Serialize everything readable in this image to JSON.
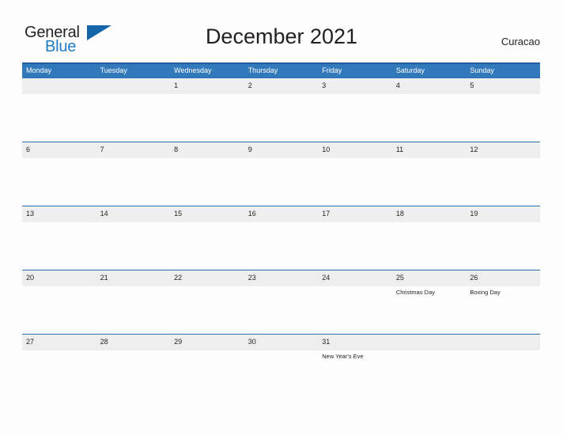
{
  "brand": {
    "name_part1": "General",
    "name_part2": "Blue",
    "flag_icon": "blue-triangle-flag"
  },
  "header": {
    "title": "December 2021",
    "region": "Curacao"
  },
  "colors": {
    "header_blue": "#3279bc",
    "divider_blue": "#2a6fb0",
    "band_gray": "#eeeeee",
    "brand_blue": "#1f7ac4",
    "text": "#231f20",
    "page_background": "#fdfdfd"
  },
  "calendar": {
    "weekday_headers": [
      "Monday",
      "Tuesday",
      "Wednesday",
      "Thursday",
      "Friday",
      "Saturday",
      "Sunday"
    ],
    "weeks": [
      [
        {
          "num": "",
          "event": ""
        },
        {
          "num": "",
          "event": ""
        },
        {
          "num": "1",
          "event": ""
        },
        {
          "num": "2",
          "event": ""
        },
        {
          "num": "3",
          "event": ""
        },
        {
          "num": "4",
          "event": ""
        },
        {
          "num": "5",
          "event": ""
        }
      ],
      [
        {
          "num": "6",
          "event": ""
        },
        {
          "num": "7",
          "event": ""
        },
        {
          "num": "8",
          "event": ""
        },
        {
          "num": "9",
          "event": ""
        },
        {
          "num": "10",
          "event": ""
        },
        {
          "num": "11",
          "event": ""
        },
        {
          "num": "12",
          "event": ""
        }
      ],
      [
        {
          "num": "13",
          "event": ""
        },
        {
          "num": "14",
          "event": ""
        },
        {
          "num": "15",
          "event": ""
        },
        {
          "num": "16",
          "event": ""
        },
        {
          "num": "17",
          "event": ""
        },
        {
          "num": "18",
          "event": ""
        },
        {
          "num": "19",
          "event": ""
        }
      ],
      [
        {
          "num": "20",
          "event": ""
        },
        {
          "num": "21",
          "event": ""
        },
        {
          "num": "22",
          "event": ""
        },
        {
          "num": "23",
          "event": ""
        },
        {
          "num": "24",
          "event": ""
        },
        {
          "num": "25",
          "event": "Christmas Day"
        },
        {
          "num": "26",
          "event": "Boxing Day"
        }
      ],
      [
        {
          "num": "27",
          "event": ""
        },
        {
          "num": "28",
          "event": ""
        },
        {
          "num": "29",
          "event": ""
        },
        {
          "num": "30",
          "event": ""
        },
        {
          "num": "31",
          "event": "New Year's Eve"
        },
        {
          "num": "",
          "event": ""
        },
        {
          "num": "",
          "event": ""
        }
      ]
    ]
  }
}
